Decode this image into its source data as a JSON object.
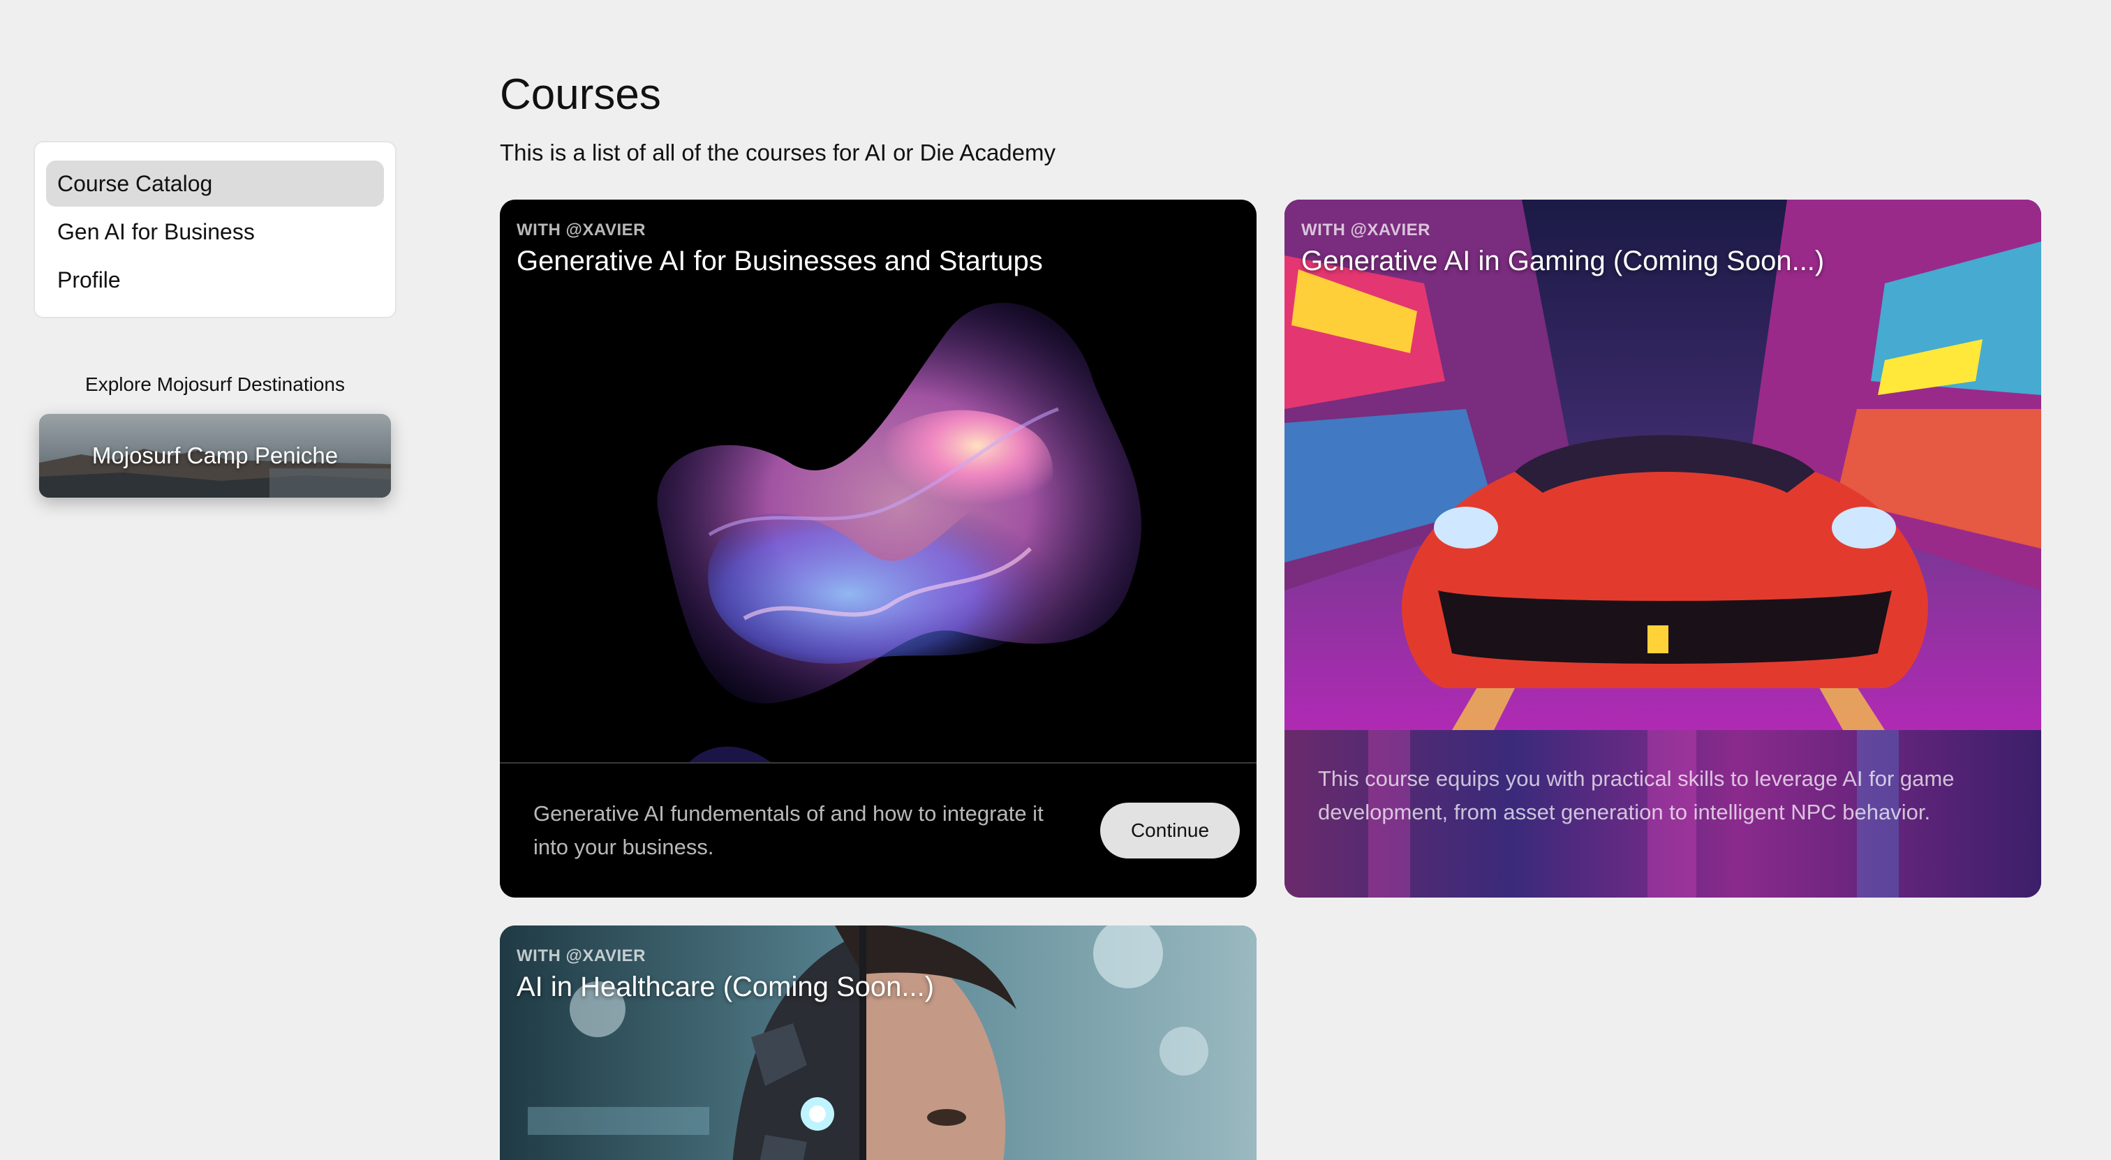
{
  "sidebar": {
    "items": [
      {
        "label": "Course Catalog"
      },
      {
        "label": "Gen AI for Business"
      },
      {
        "label": "Profile"
      }
    ],
    "explore_label": "Explore Mojosurf Destinations",
    "destination": {
      "label": "Mojosurf Camp Peniche"
    }
  },
  "main": {
    "title": "Courses",
    "subtitle": "This is a list of all of the courses for AI or Die Academy"
  },
  "courses": [
    {
      "instructor": "WITH @XAVIER",
      "title": "Generative AI for Businesses and Startups",
      "description": "Generative AI fundementals of and how to integrate it into your business.",
      "button": "Continue"
    },
    {
      "instructor": "WITH @XAVIER",
      "title": "Generative AI in Gaming (Coming Soon...)",
      "description": "This course equips you with practical skills to leverage AI for game development, from asset generation to intelligent NPC behavior."
    },
    {
      "instructor": "WITH @XAVIER",
      "title": "AI in Healthcare (Coming Soon...)"
    }
  ],
  "colors": {
    "background": "#efefef",
    "active_item": "#dcdcdc",
    "card_dark": "#000000",
    "button": "#e2e2e2"
  }
}
